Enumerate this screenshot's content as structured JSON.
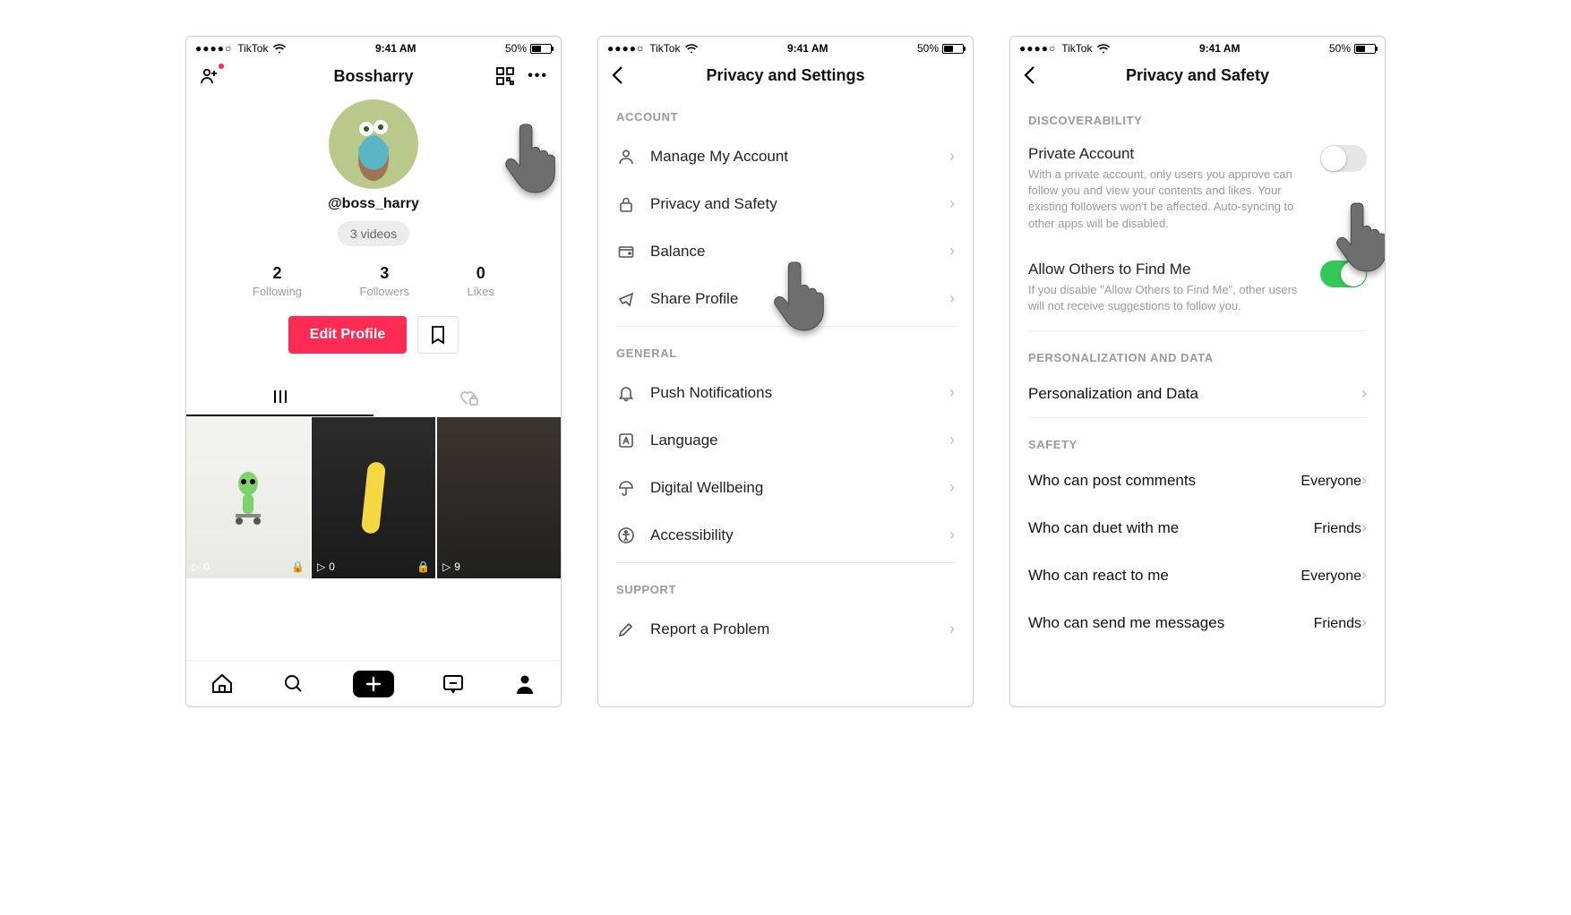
{
  "status": {
    "carrier": "TikTok",
    "time": "9:41 AM",
    "battery": "50%"
  },
  "profile": {
    "title": "Bossharry",
    "handle": "@boss_harry",
    "videos_pill": "3 videos",
    "stats": {
      "following_num": "2",
      "following_lbl": "Following",
      "followers_num": "3",
      "followers_lbl": "Followers",
      "likes_num": "0",
      "likes_lbl": "Likes"
    },
    "edit_label": "Edit Profile",
    "thumbs": [
      {
        "plays": "0",
        "locked": true
      },
      {
        "plays": "0",
        "locked": true
      },
      {
        "plays": "9",
        "locked": false
      }
    ]
  },
  "settings": {
    "title": "Privacy and Settings",
    "sections": {
      "account": {
        "header": "ACCOUNT",
        "items": [
          "Manage My Account",
          "Privacy and Safety",
          "Balance",
          "Share Profile"
        ]
      },
      "general": {
        "header": "GENERAL",
        "items": [
          "Push Notifications",
          "Language",
          "Digital Wellbeing",
          "Accessibility"
        ]
      },
      "support": {
        "header": "SUPPORT",
        "items": [
          "Report a Problem"
        ]
      }
    }
  },
  "privacy": {
    "title": "Privacy and Safety",
    "discoverability": {
      "header": "DISCOVERABILITY",
      "private_label": "Private Account",
      "private_desc": "With a private account, only users you approve can follow you and view your contents and likes. Your existing followers won't be affected. Auto-syncing to other apps will be disabled.",
      "find_label": "Allow Others to Find Me",
      "find_desc": "If you disable \"Allow Others to Find Me\", other users will not receive suggestions to follow you."
    },
    "personalization": {
      "header": "PERSONALIZATION AND DATA",
      "item": "Personalization and Data"
    },
    "safety": {
      "header": "SAFETY",
      "rows": [
        {
          "label": "Who can post comments",
          "value": "Everyone"
        },
        {
          "label": "Who can duet with me",
          "value": "Friends"
        },
        {
          "label": "Who can react to me",
          "value": "Everyone"
        },
        {
          "label": "Who can send me messages",
          "value": "Friends"
        }
      ]
    }
  }
}
